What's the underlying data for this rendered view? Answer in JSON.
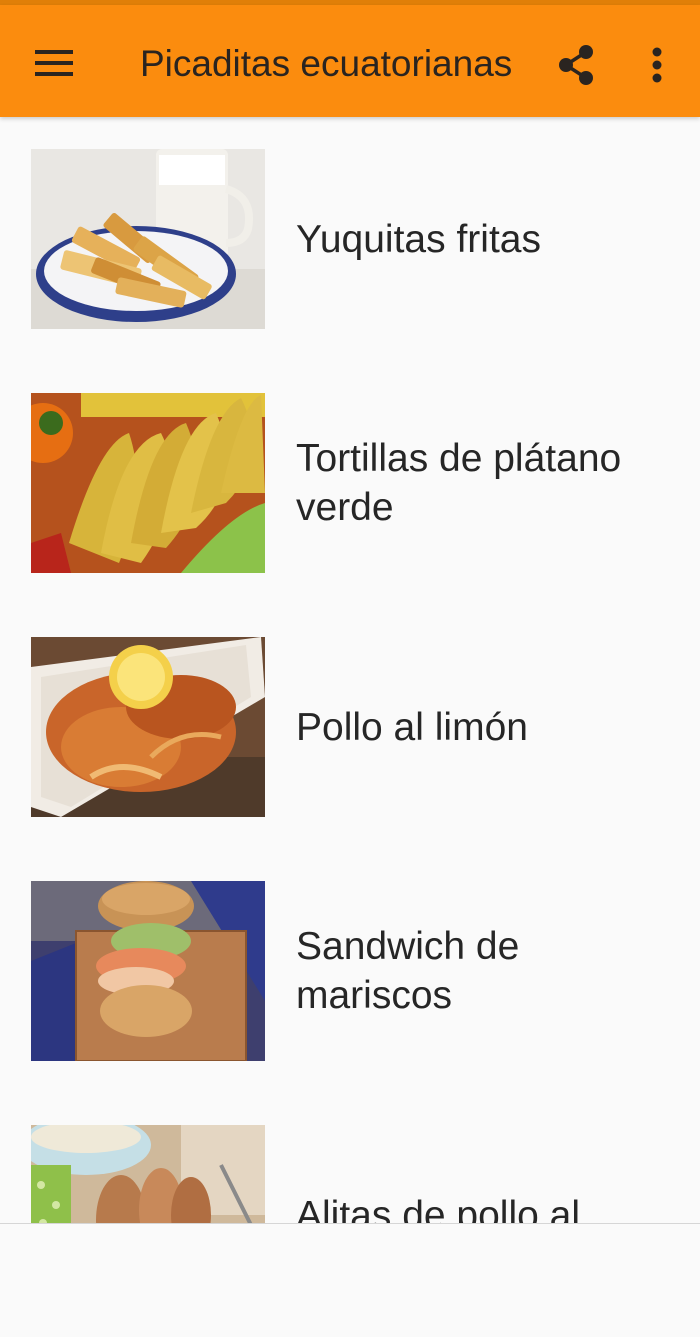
{
  "appbar": {
    "title": "Picaditas ecuatorianas",
    "background": "#fb8c0e",
    "icons": {
      "menu": "hamburger-menu-icon",
      "share": "share-icon",
      "more": "more-vert-icon"
    }
  },
  "recipes": [
    {
      "title": "Yuquitas fritas",
      "image": "fried-cassava-photo"
    },
    {
      "title": "Tortillas de plátano verde",
      "image": "green-plantain-tortillas-photo"
    },
    {
      "title": "Pollo al limón",
      "image": "lemon-chicken-photo"
    },
    {
      "title": "Sandwich de mariscos",
      "image": "seafood-sandwich-photo"
    },
    {
      "title": "Alitas de pollo al",
      "image": "chicken-wings-photo"
    }
  ]
}
